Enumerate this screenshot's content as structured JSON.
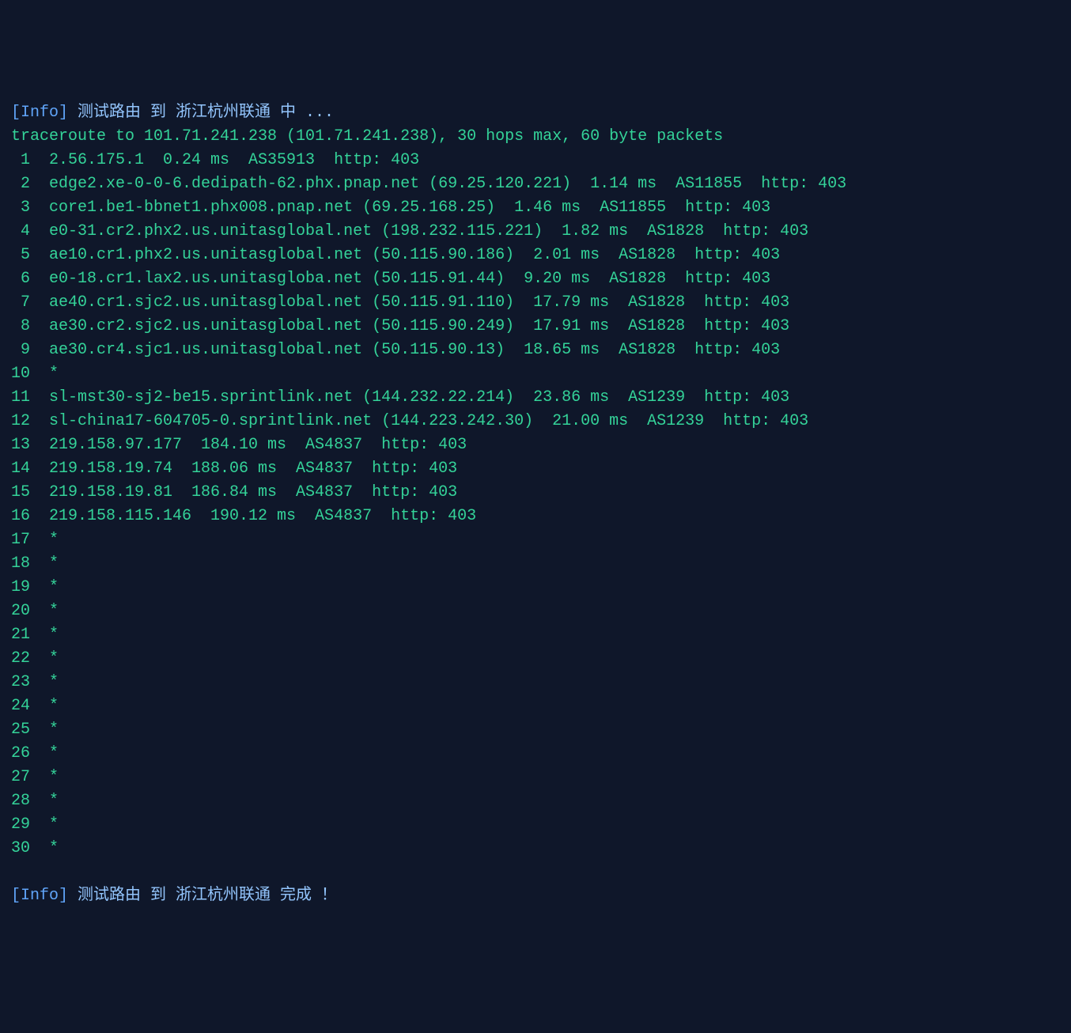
{
  "info_start": {
    "tag": "[Info]",
    "text": " 测试路由 到 浙江杭州联通 中 ..."
  },
  "traceroute_header": "traceroute to 101.71.241.238 (101.71.241.238), 30 hops max, 60 byte packets",
  "hops": [
    {
      "num": " 1",
      "content": "  2.56.175.1  0.24 ms  AS35913  http: 403"
    },
    {
      "num": " 2",
      "content": "  edge2.xe-0-0-6.dedipath-62.phx.pnap.net (69.25.120.221)  1.14 ms  AS11855  http: 403"
    },
    {
      "num": " 3",
      "content": "  core1.be1-bbnet1.phx008.pnap.net (69.25.168.25)  1.46 ms  AS11855  http: 403"
    },
    {
      "num": " 4",
      "content": "  e0-31.cr2.phx2.us.unitasglobal.net (198.232.115.221)  1.82 ms  AS1828  http: 403"
    },
    {
      "num": " 5",
      "content": "  ae10.cr1.phx2.us.unitasglobal.net (50.115.90.186)  2.01 ms  AS1828  http: 403"
    },
    {
      "num": " 6",
      "content": "  e0-18.cr1.lax2.us.unitasgloba.net (50.115.91.44)  9.20 ms  AS1828  http: 403"
    },
    {
      "num": " 7",
      "content": "  ae40.cr1.sjc2.us.unitasglobal.net (50.115.91.110)  17.79 ms  AS1828  http: 403"
    },
    {
      "num": " 8",
      "content": "  ae30.cr2.sjc2.us.unitasglobal.net (50.115.90.249)  17.91 ms  AS1828  http: 403"
    },
    {
      "num": " 9",
      "content": "  ae30.cr4.sjc1.us.unitasglobal.net (50.115.90.13)  18.65 ms  AS1828  http: 403"
    },
    {
      "num": "10",
      "content": "  *"
    },
    {
      "num": "11",
      "content": "  sl-mst30-sj2-be15.sprintlink.net (144.232.22.214)  23.86 ms  AS1239  http: 403"
    },
    {
      "num": "12",
      "content": "  sl-china17-604705-0.sprintlink.net (144.223.242.30)  21.00 ms  AS1239  http: 403"
    },
    {
      "num": "13",
      "content": "  219.158.97.177  184.10 ms  AS4837  http: 403"
    },
    {
      "num": "14",
      "content": "  219.158.19.74  188.06 ms  AS4837  http: 403"
    },
    {
      "num": "15",
      "content": "  219.158.19.81  186.84 ms  AS4837  http: 403"
    },
    {
      "num": "16",
      "content": "  219.158.115.146  190.12 ms  AS4837  http: 403"
    },
    {
      "num": "17",
      "content": "  *"
    },
    {
      "num": "18",
      "content": "  *"
    },
    {
      "num": "19",
      "content": "  *"
    },
    {
      "num": "20",
      "content": "  *"
    },
    {
      "num": "21",
      "content": "  *"
    },
    {
      "num": "22",
      "content": "  *"
    },
    {
      "num": "23",
      "content": "  *"
    },
    {
      "num": "24",
      "content": "  *"
    },
    {
      "num": "25",
      "content": "  *"
    },
    {
      "num": "26",
      "content": "  *"
    },
    {
      "num": "27",
      "content": "  *"
    },
    {
      "num": "28",
      "content": "  *"
    },
    {
      "num": "29",
      "content": "  *"
    },
    {
      "num": "30",
      "content": "  *"
    }
  ],
  "info_end": {
    "tag": "[Info]",
    "text": " 测试路由 到 浙江杭州联通 完成 ！"
  }
}
